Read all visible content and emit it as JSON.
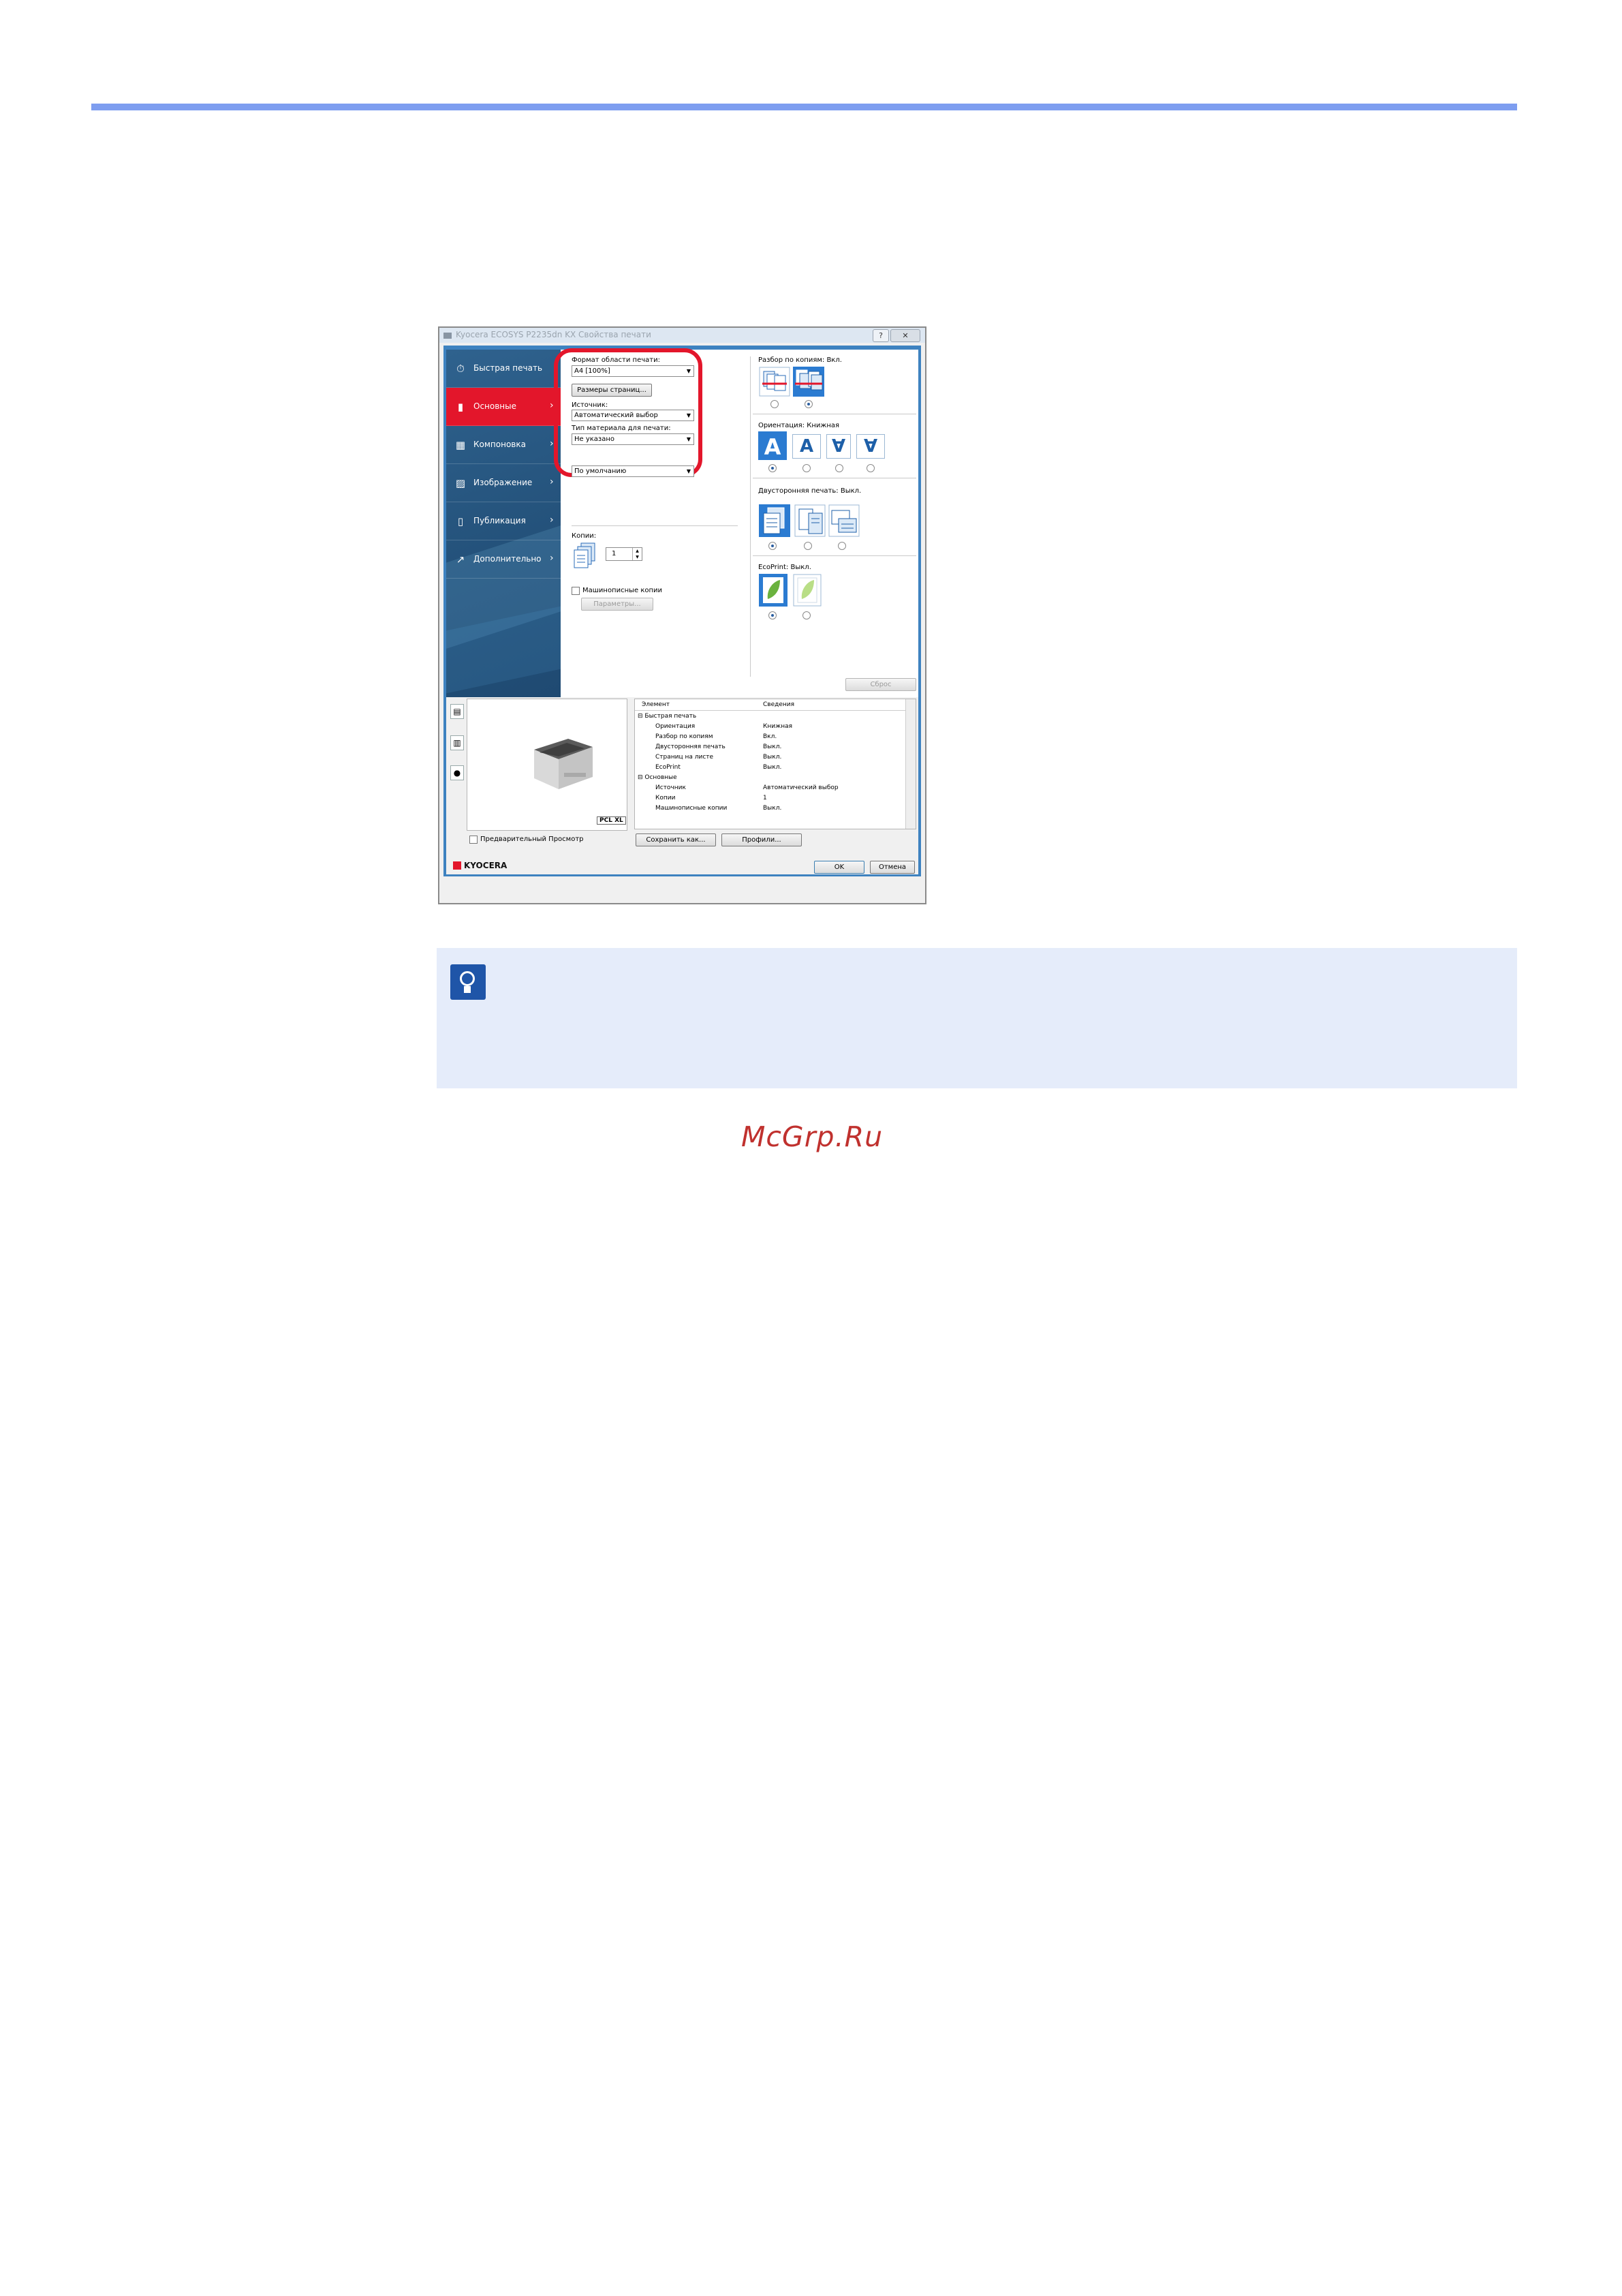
{
  "window": {
    "title": "Kyocera ECOSYS P2235dn KX Свойства печати",
    "help_label": "?",
    "close_label": "✕"
  },
  "nav": {
    "items": [
      {
        "label": "Быстрая печать",
        "icon": "stopwatch-icon"
      },
      {
        "label": "Основные",
        "icon": "page-icon",
        "active": true
      },
      {
        "label": "Компоновка",
        "icon": "layout-grid-icon"
      },
      {
        "label": "Изображение",
        "icon": "image-chart-icon"
      },
      {
        "label": "Публикация",
        "icon": "publish-icon"
      },
      {
        "label": "Дополнительно",
        "icon": "arrow-icon"
      }
    ]
  },
  "basic": {
    "print_size_label": "Формат области печати:",
    "print_size_value": "A4 [100%]",
    "page_sizes_button": "Размеры страниц...",
    "source_label": "Источник:",
    "source_value": "Автоматический выбор",
    "media_type_label": "Тип материала для печати:",
    "media_type_value": "Не указано",
    "default_value": "По умолчанию",
    "copies_label": "Копии:",
    "copies_value": "1",
    "typewriter_label": "Машинописные копии",
    "parameters_button": "Параметры..."
  },
  "right": {
    "collate_label": "Разбор по копиям:",
    "collate_value": "Вкл.",
    "orientation_label": "Ориентация:",
    "orientation_value": "Книжная",
    "orientation_glyphs": [
      "A",
      "A",
      "∀",
      "∀"
    ],
    "duplex_label": "Двусторонняя печать:",
    "duplex_value": "Выкл.",
    "ecoprint_label": "EcoPrint:",
    "ecoprint_value": "Выкл.",
    "reset_button": "Сброс"
  },
  "summary": {
    "col_item": "Элемент",
    "col_details": "Сведения",
    "rows": [
      {
        "item": "⊟ Быстрая печать",
        "details": ""
      },
      {
        "item": "Ориентация",
        "details": "Книжная"
      },
      {
        "item": "Разбор по копиям",
        "details": "Вкл."
      },
      {
        "item": "Двусторонняя печать",
        "details": "Выкл."
      },
      {
        "item": "Страниц на листе",
        "details": "Выкл."
      },
      {
        "item": "EcoPrint",
        "details": "Выкл."
      },
      {
        "item": "⊟ Основные",
        "details": ""
      },
      {
        "item": "Источник",
        "details": "Автоматический выбор"
      },
      {
        "item": "Копии",
        "details": "1"
      },
      {
        "item": "Машинописные копии",
        "details": "Выкл."
      }
    ]
  },
  "bottom": {
    "pcl_label": "PCL XL",
    "preview_label": "Предварительный Просмотр",
    "save_as_button": "Сохранить как...",
    "profiles_button": "Профили...",
    "ok_button": "OK",
    "cancel_button": "Отмена",
    "logo_text": "KYOCERA"
  },
  "watermark": "McGrp.Ru",
  "colors": {
    "accent_red": "#e3162b",
    "nav_blue": "#24527b",
    "select_blue": "#2b7bd1",
    "tip_bg": "#e5ecfa",
    "rule_blue": "#7e9ef0"
  }
}
